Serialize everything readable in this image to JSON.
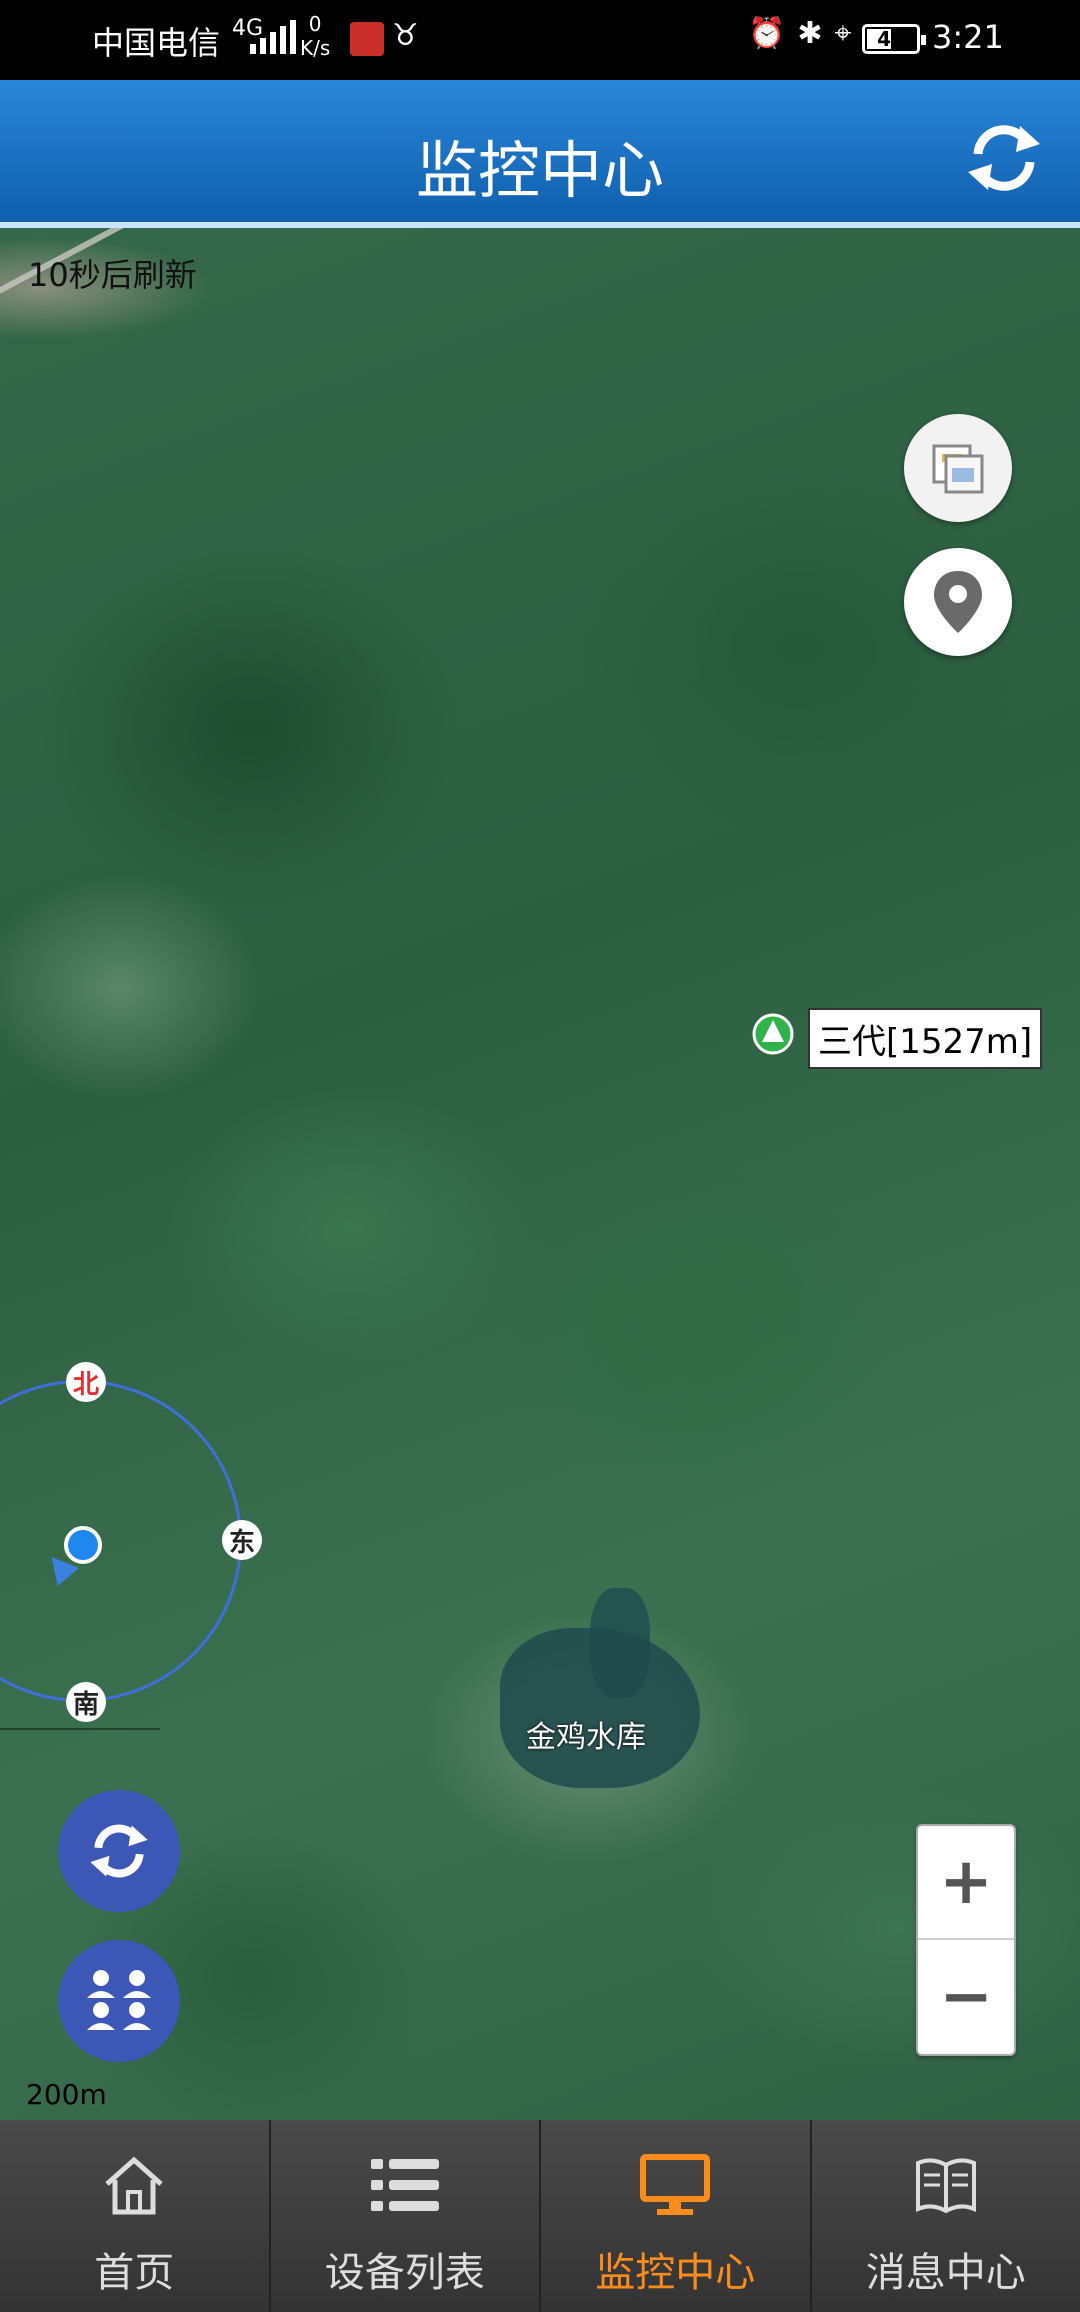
{
  "status_bar": {
    "carrier": "中国电信",
    "network": "4G",
    "speed_value": "0",
    "speed_unit": "K/s",
    "battery": "41",
    "time": "3:21"
  },
  "header": {
    "title": "监控中心",
    "refresh_icon": "refresh-icon"
  },
  "map": {
    "refresh_countdown": "10秒后刷新",
    "device_label": "三代[1527m]",
    "compass": {
      "north": "北",
      "east": "东",
      "south": "南"
    },
    "reservoir_label": "金鸡水库",
    "scale": "200m",
    "zoom_in": "+",
    "zoom_out": "−"
  },
  "bottom_nav": {
    "items": [
      {
        "label": "首页",
        "icon": "home-icon",
        "active": false
      },
      {
        "label": "设备列表",
        "icon": "list-icon",
        "active": false
      },
      {
        "label": "监控中心",
        "icon": "monitor-icon",
        "active": true
      },
      {
        "label": "消息中心",
        "icon": "book-icon",
        "active": false
      }
    ]
  },
  "colors": {
    "header_blue": "#1a6fc4",
    "active_orange": "#ff8c1a",
    "fab_blue": "#3c57b5"
  }
}
